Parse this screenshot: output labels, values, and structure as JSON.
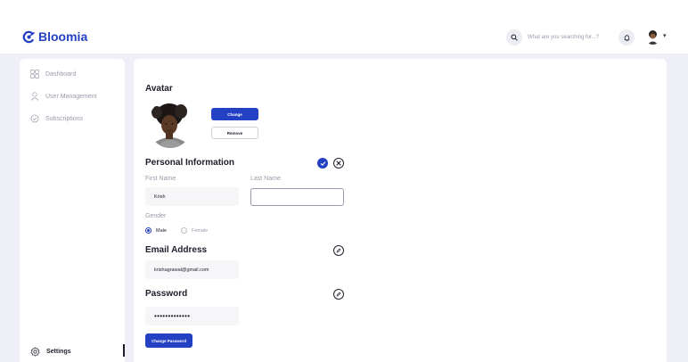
{
  "app": {
    "name": "Bloomia"
  },
  "header": {
    "search_placeholder": "What are you searching for...?"
  },
  "sidebar": {
    "items": [
      {
        "label": "Dashboard",
        "icon": "grid-icon"
      },
      {
        "label": "User Management",
        "icon": "user-icon"
      },
      {
        "label": "Subscriptions",
        "icon": "subscription-icon"
      }
    ],
    "footer_item": {
      "label": "Settings",
      "icon": "gear-icon"
    }
  },
  "avatar_section": {
    "title": "Avatar",
    "change_label": "Change",
    "remove_label": "Remove"
  },
  "personal": {
    "title": "Personal Information",
    "first_name_label": "First Name",
    "first_name_value": "Krish",
    "last_name_label": "Last Name",
    "last_name_value": "",
    "gender_label": "Gender",
    "gender_options": [
      {
        "label": "Male",
        "selected": true
      },
      {
        "label": "Female",
        "selected": false
      }
    ]
  },
  "email": {
    "title": "Email Address",
    "value": "krishagrawal@gmail.com"
  },
  "password": {
    "title": "Password",
    "value": "•••••••••••••",
    "change_label": "Change Password"
  },
  "colors": {
    "accent": "#2541c3",
    "background": "#efeff8",
    "text": "#1d1d2b",
    "muted": "#9a9aab"
  }
}
